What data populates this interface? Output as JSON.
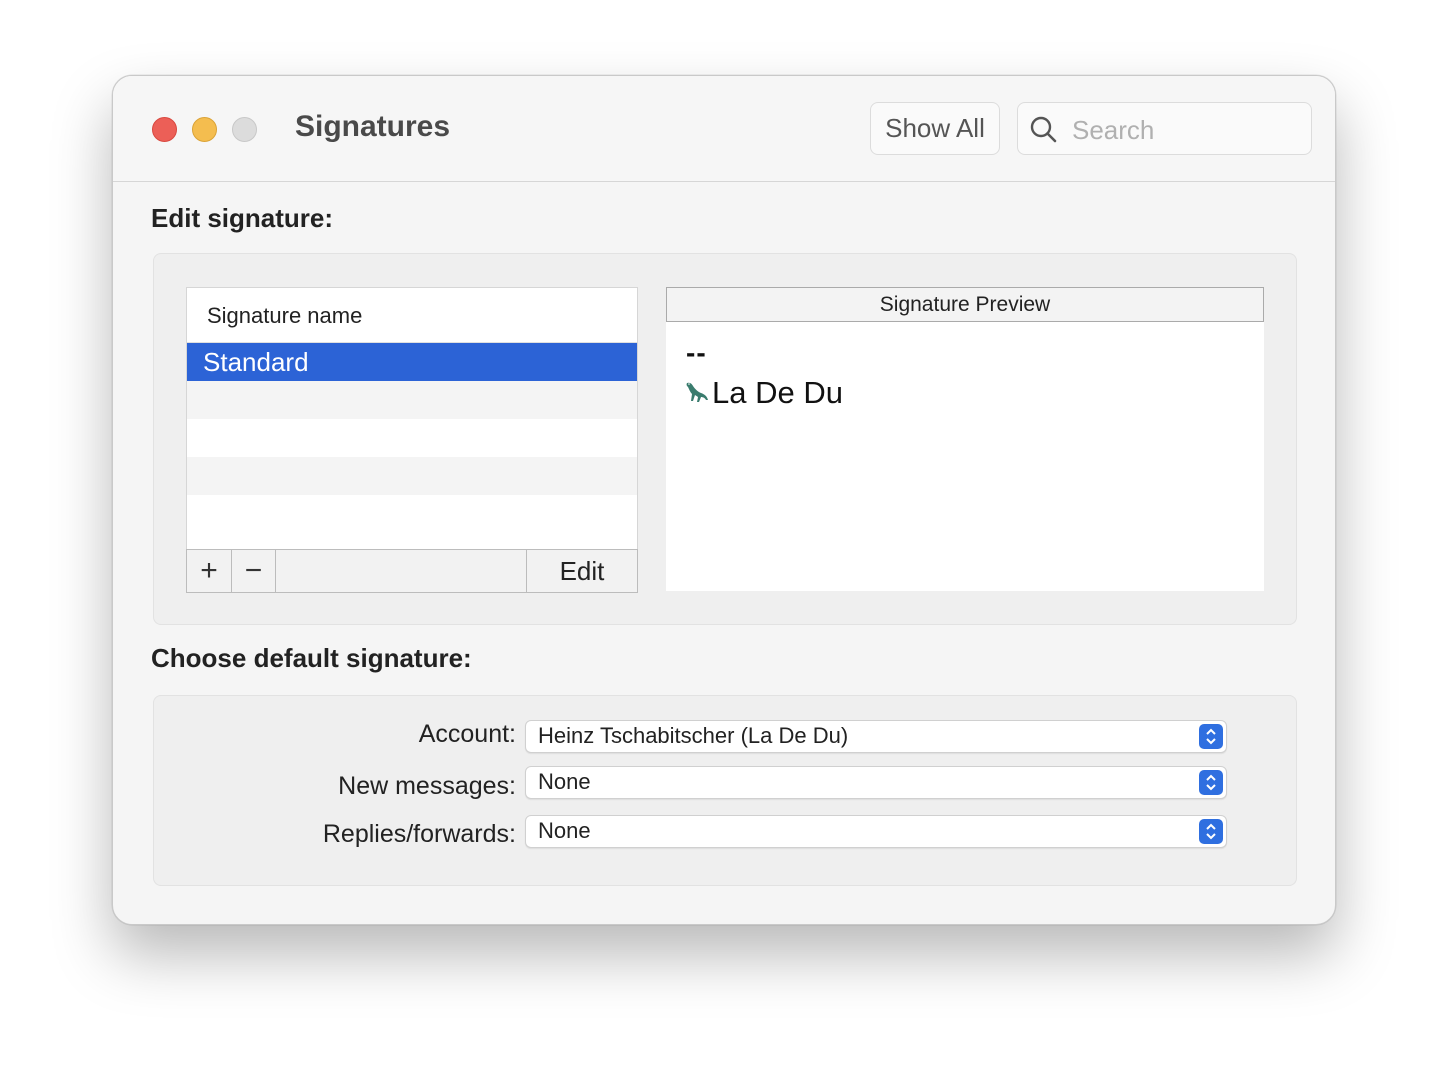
{
  "window": {
    "title": "Signatures",
    "show_all_label": "Show All",
    "search_placeholder": "Search"
  },
  "edit_section": {
    "label": "Edit signature:",
    "list_header": "Signature name",
    "signatures": [
      "Standard"
    ],
    "selected_index": 0,
    "add_label": "+",
    "remove_label": "−",
    "edit_label": "Edit",
    "preview_header": "Signature Preview",
    "preview_dashes": "--",
    "preview_text": "La De Du",
    "preview_icon": "dinosaur-icon"
  },
  "default_section": {
    "label": "Choose default signature:",
    "rows": [
      {
        "label": "Account:",
        "value": "Heinz Tschabitscher (La De Du)"
      },
      {
        "label": "New messages:",
        "value": "None"
      },
      {
        "label": "Replies/forwards:",
        "value": "None"
      }
    ]
  },
  "colors": {
    "accent": "#2c63d6",
    "close": "#ec5f57",
    "minimize": "#f4bd4f",
    "zoom_disabled": "#dcdcdc"
  }
}
